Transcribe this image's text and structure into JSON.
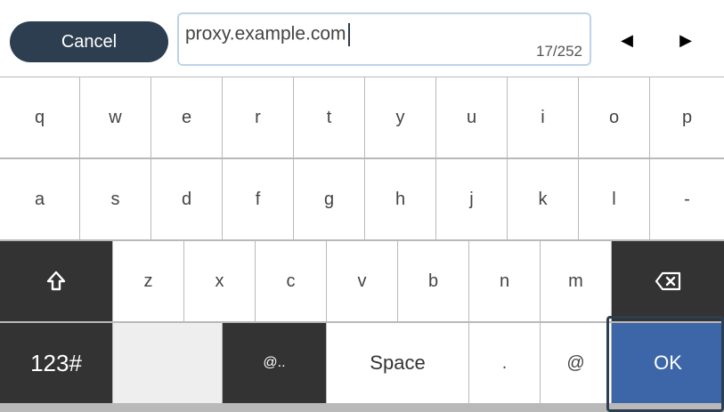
{
  "toolbar": {
    "cancel_label": "Cancel"
  },
  "input": {
    "value": "proxy.example.com",
    "char_count": "17/252"
  },
  "nav": {
    "left": "◀",
    "right": "▶"
  },
  "keys": {
    "row1": [
      "q",
      "w",
      "e",
      "r",
      "t",
      "y",
      "u",
      "i",
      "o",
      "p"
    ],
    "row2": [
      "a",
      "s",
      "d",
      "f",
      "g",
      "h",
      "j",
      "k",
      "l",
      "-"
    ],
    "row3": [
      "z",
      "x",
      "c",
      "v",
      "b",
      "n",
      "m"
    ],
    "mode_label": "123#",
    "at_dot_label": "@..",
    "space_label": "Space",
    "dot_label": ".",
    "at_label": "@",
    "ok_label": "OK"
  },
  "icons": {
    "shift": "shift-icon",
    "backspace": "backspace-icon"
  },
  "colors": {
    "cancel_bg": "#2d3e50",
    "ok_bg": "#3c66a8",
    "dark_key": "#333333"
  }
}
